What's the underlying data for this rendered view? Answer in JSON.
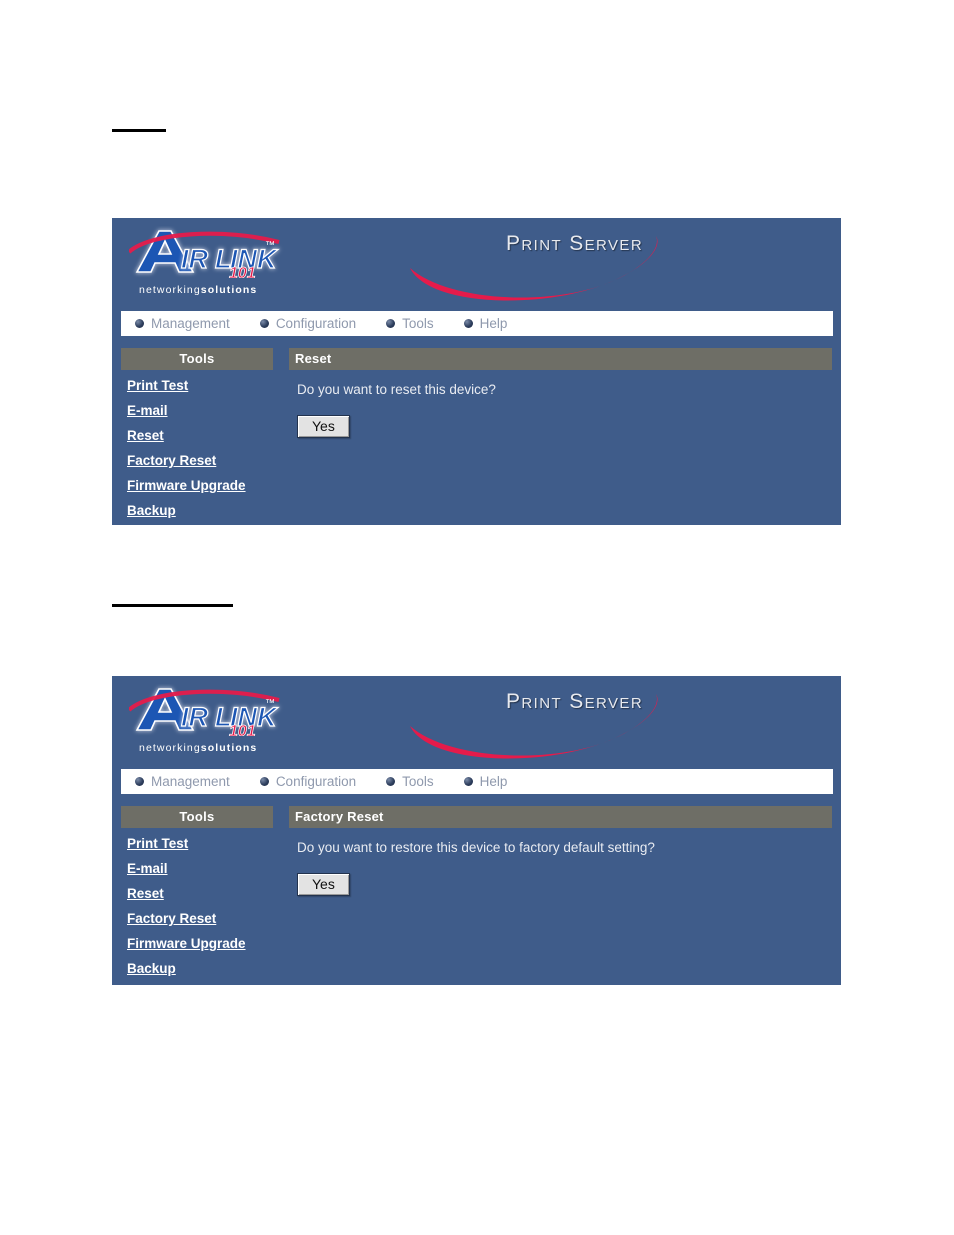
{
  "document": {
    "headings": [
      {
        "id": "reset-heading",
        "text": ""
      },
      {
        "id": "factory-reset-heading",
        "text": ""
      }
    ]
  },
  "branding": {
    "logo_name": "AirLink",
    "logo_suffix": "101",
    "tagline_light": "networking",
    "tagline_bold": "solutions",
    "product_title": "Print Server",
    "swoosh_color": "#e51b4b",
    "logo_blue": "#1e56b4",
    "panel_blue": "#3f5c8a",
    "bar_gray": "#6e6e66"
  },
  "nav": {
    "items": [
      {
        "label": "Management",
        "icon": "sphere-bullet-icon"
      },
      {
        "label": "Configuration",
        "icon": "sphere-bullet-icon"
      },
      {
        "label": "Tools",
        "icon": "sphere-bullet-icon"
      },
      {
        "label": "Help",
        "icon": "sphere-bullet-icon"
      }
    ]
  },
  "sidebar": {
    "title": "Tools",
    "items": [
      {
        "label": "Print Test"
      },
      {
        "label": "E-mail"
      },
      {
        "label": "Reset"
      },
      {
        "label": "Factory Reset"
      },
      {
        "label": "Firmware Upgrade"
      },
      {
        "label": "Backup"
      }
    ]
  },
  "screens": [
    {
      "panel_title": "Reset",
      "question": "Do you want to reset this device?",
      "confirm_label": "Yes"
    },
    {
      "panel_title": "Factory Reset",
      "question": "Do you want to restore this device to factory default setting?",
      "confirm_label": "Yes"
    }
  ]
}
